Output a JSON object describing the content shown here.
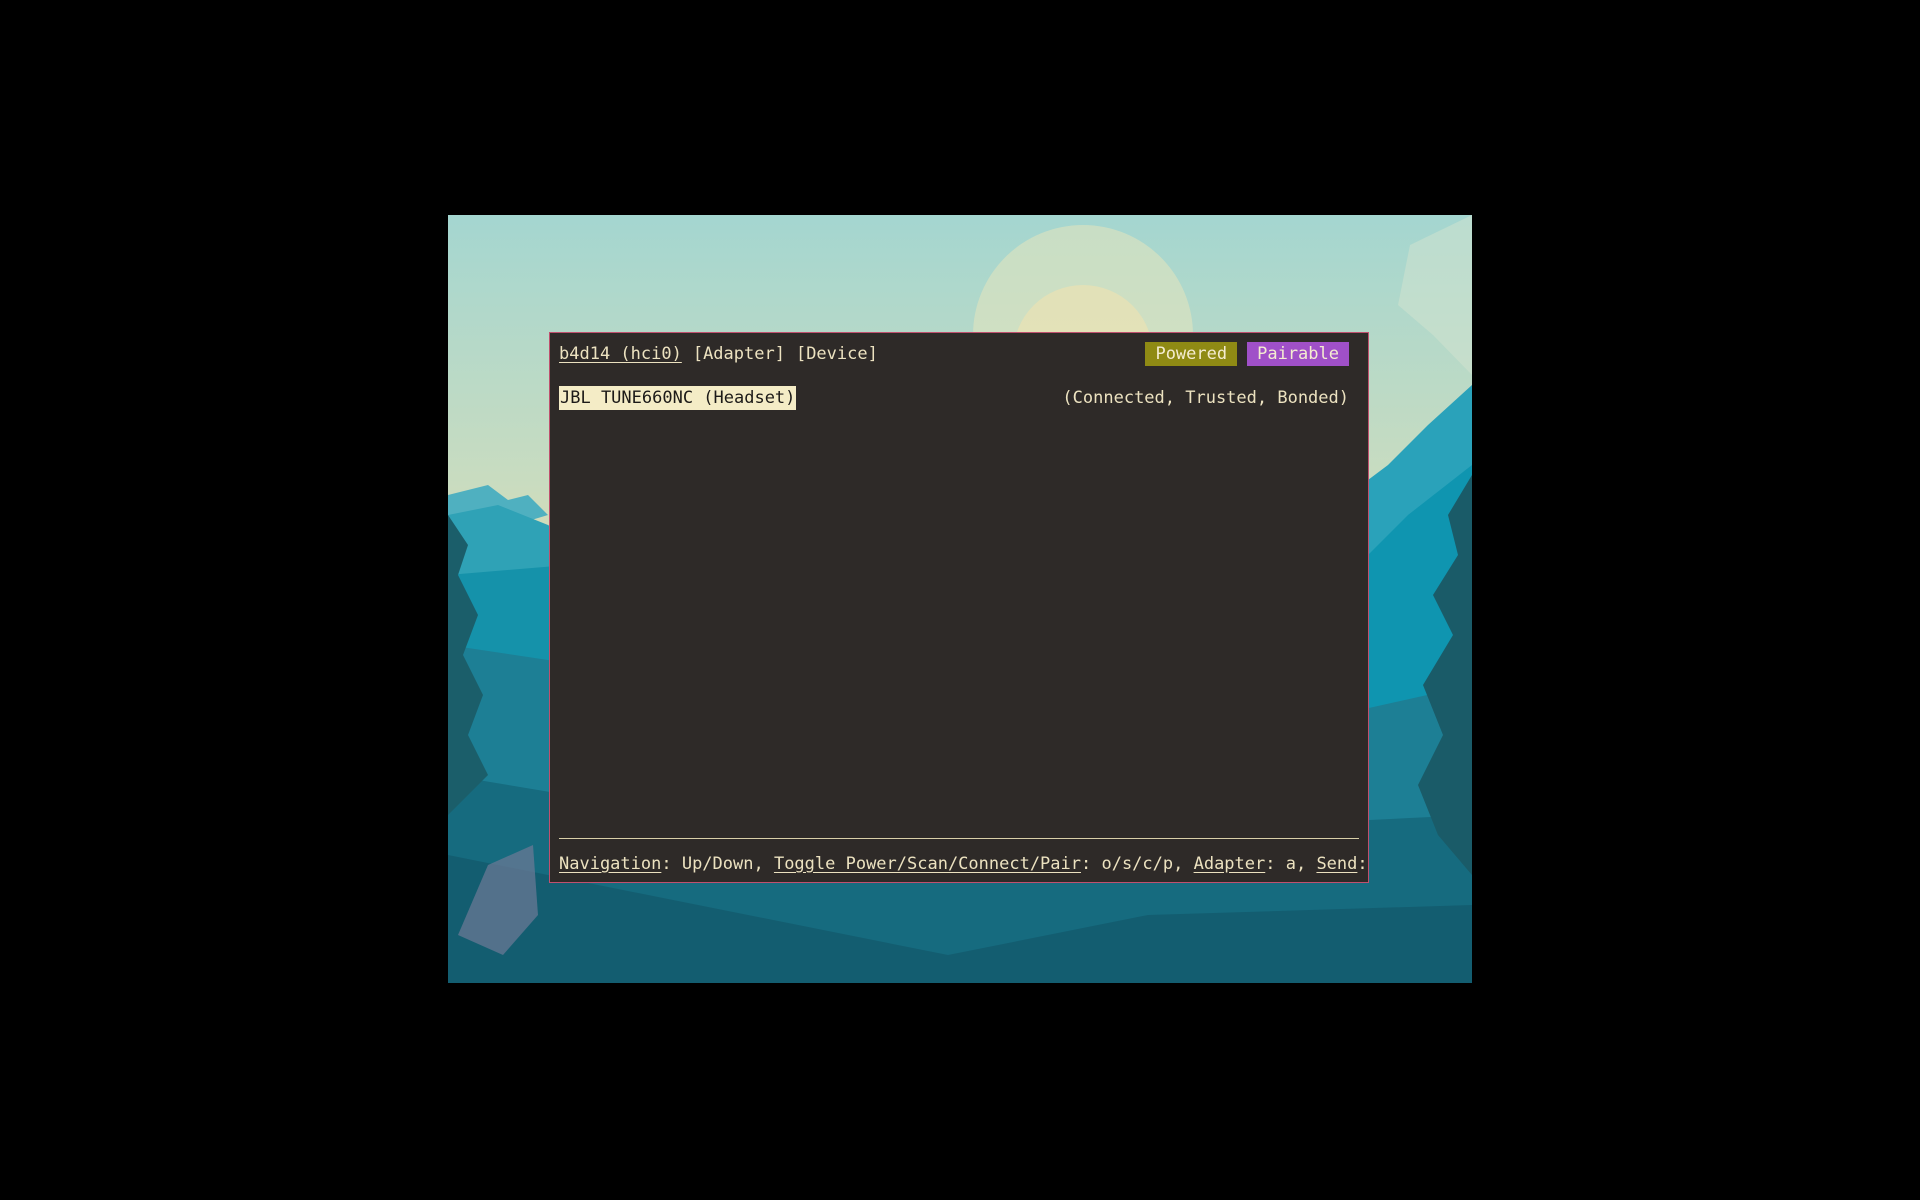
{
  "header": {
    "adapter_name": "b4d14 (hci0)",
    "tabs": [
      "[Adapter]",
      "[Device]"
    ],
    "badges": {
      "powered": "Powered",
      "pairable": "Pairable"
    }
  },
  "devices": [
    {
      "name": "JBL TUNE660NC (Headset)",
      "status": "(Connected, Trusted, Bonded)"
    }
  ],
  "footer": {
    "nav_key": "Navigation",
    "nav_val": ": Up/Down, ",
    "toggle_key": "Toggle Power/Scan/Connect/Pair",
    "toggle_val": ": o/s/c/p, ",
    "adapter_key": "Adapter",
    "adapter_val": ": a, ",
    "send_key": "Send",
    "send_val": ":"
  },
  "colors": {
    "terminal_bg": "#2e2a28",
    "text": "#ece2c0",
    "border": "#c0506e",
    "powered": "#8f8a14",
    "pairable": "#a050c8"
  }
}
